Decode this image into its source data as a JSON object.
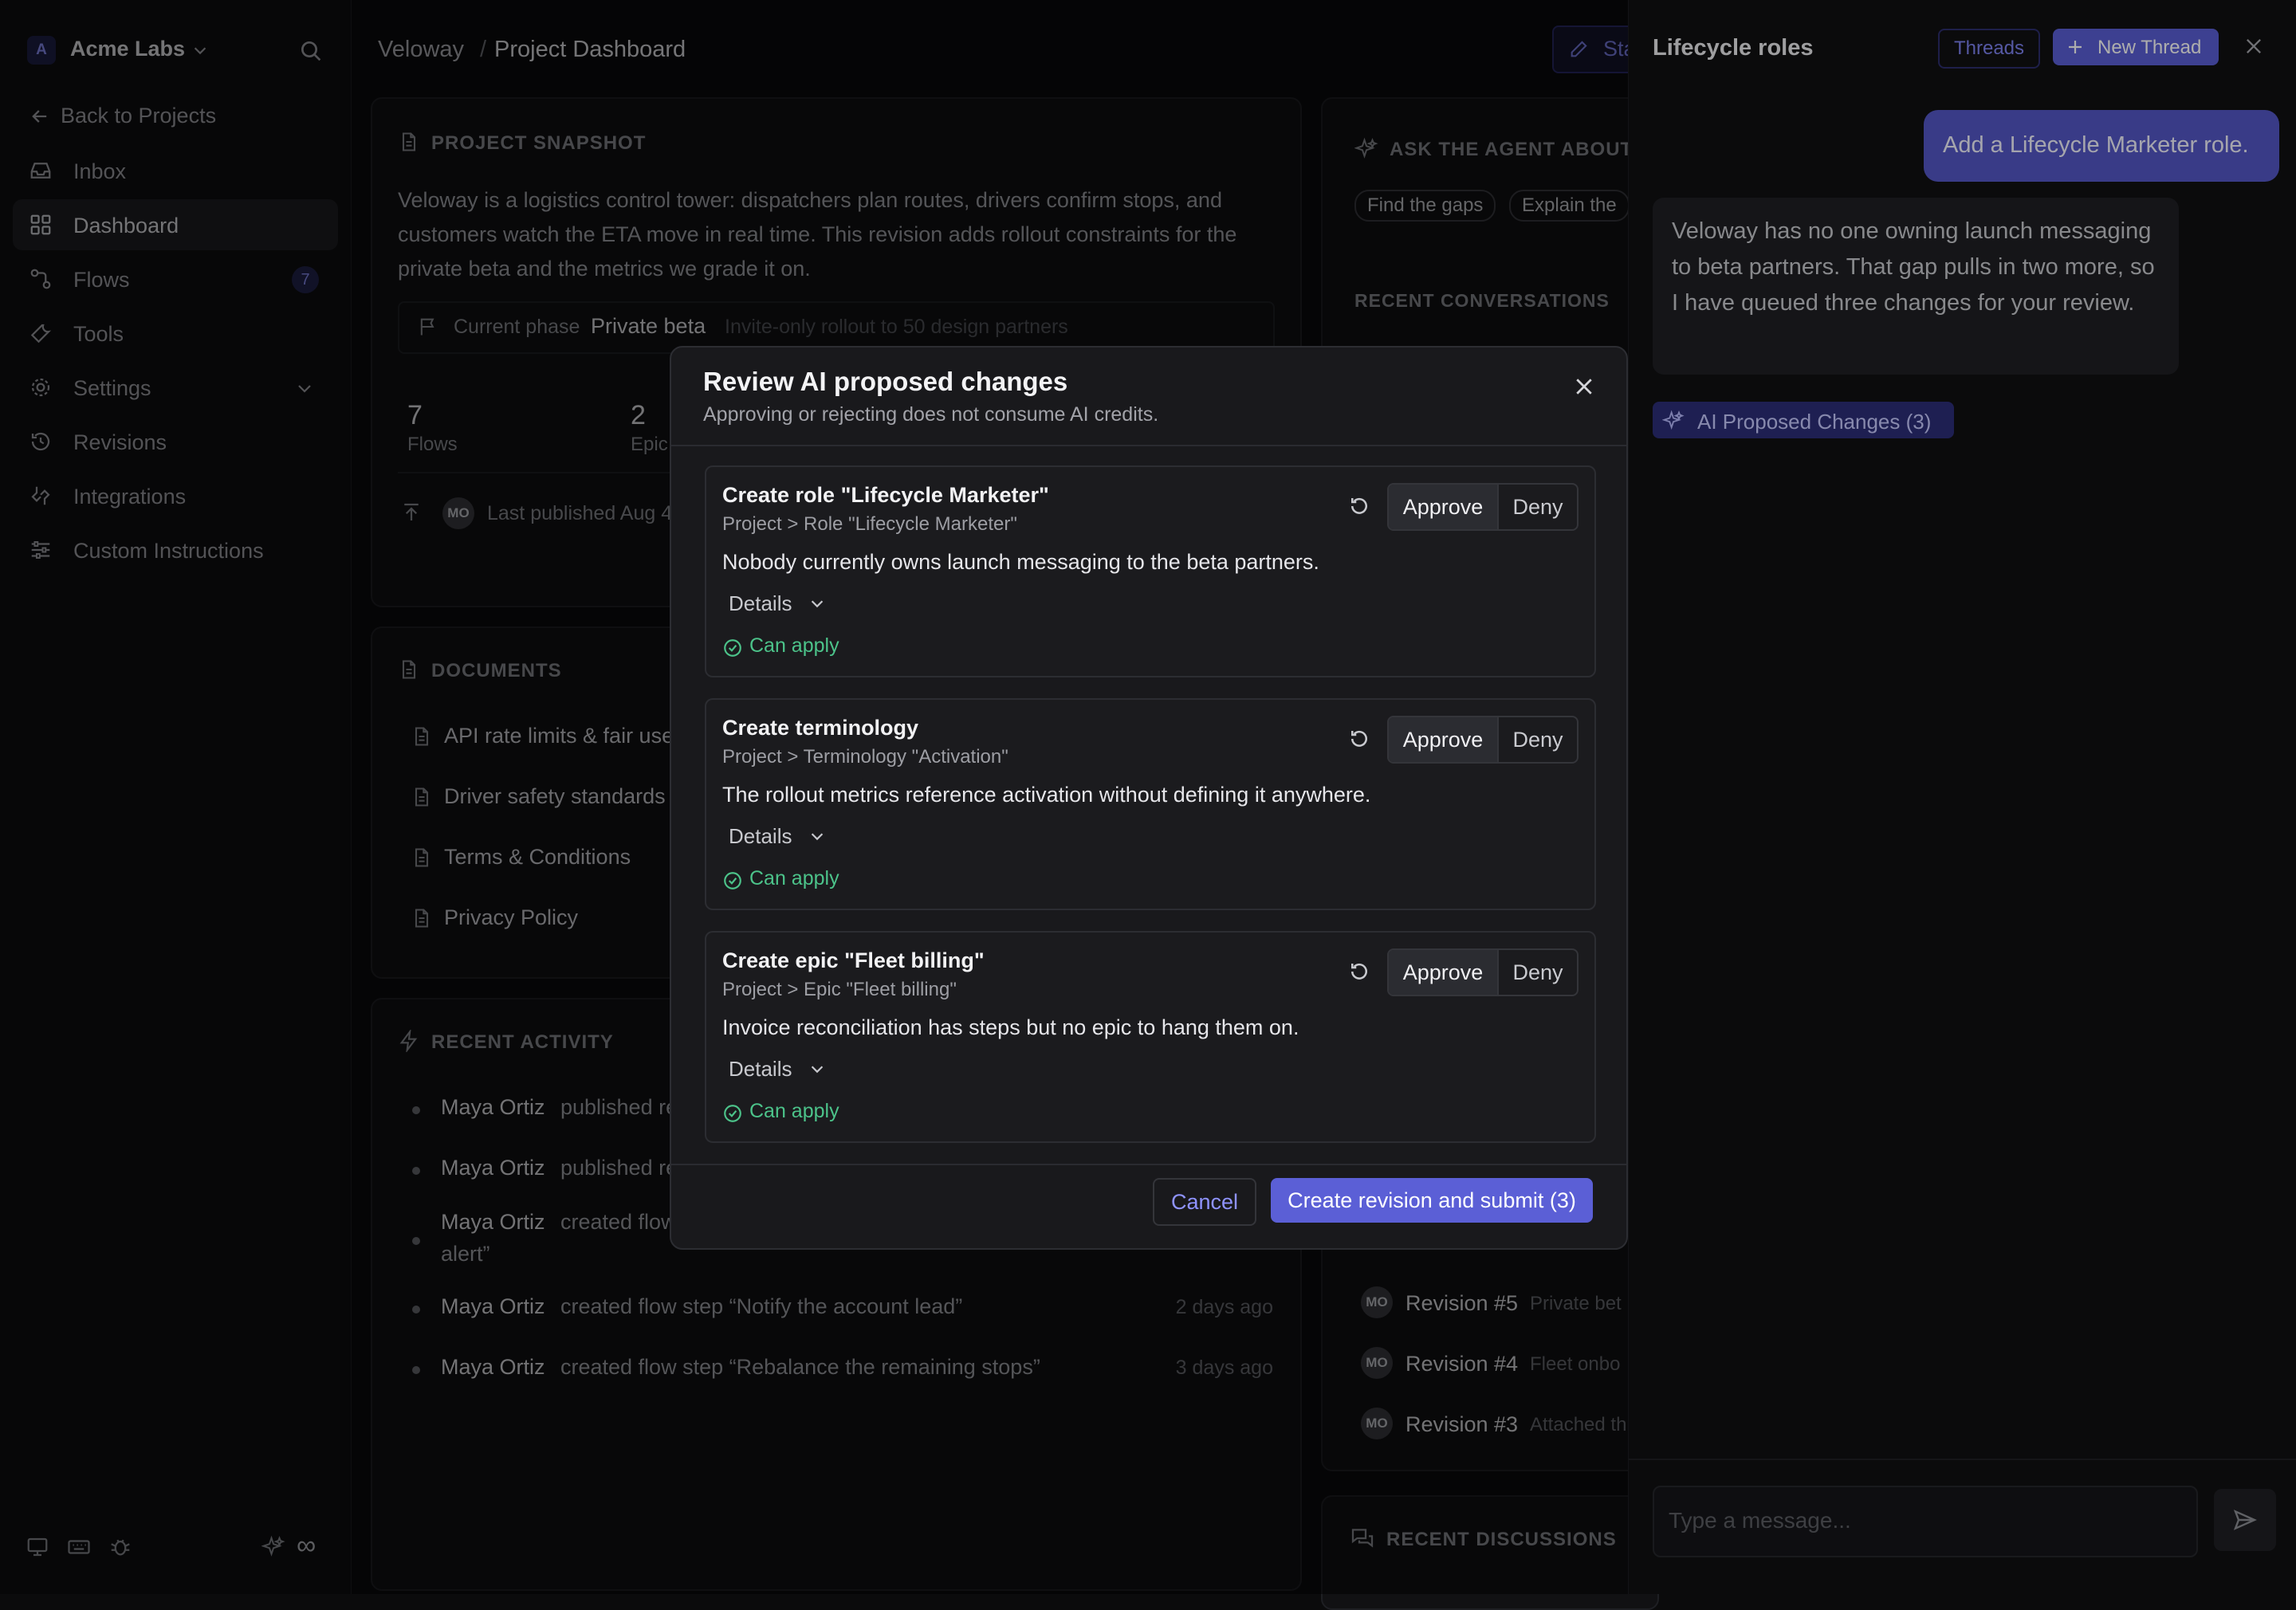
{
  "workspace": {
    "initial": "A",
    "name": "Acme Labs"
  },
  "sidebar": {
    "back": "Back to Projects",
    "items": [
      {
        "label": "Inbox",
        "icon": "inbox-icon"
      },
      {
        "label": "Dashboard",
        "icon": "grid-icon",
        "active": true
      },
      {
        "label": "Flows",
        "icon": "flows-icon",
        "badge": "7"
      },
      {
        "label": "Tools",
        "icon": "wrench-icon"
      },
      {
        "label": "Settings",
        "icon": "gear-icon"
      },
      {
        "label": "Revisions",
        "icon": "history-icon"
      },
      {
        "label": "Integrations",
        "icon": "integrations-icon"
      },
      {
        "label": "Custom Instructions",
        "icon": "sliders-icon"
      }
    ],
    "footer_infinity": "∞"
  },
  "breadcrumb": {
    "project": "Veloway",
    "separator": "/",
    "page": "Project Dashboard"
  },
  "header_button_partial": "Sta",
  "snapshot": {
    "title": "PROJECT SNAPSHOT",
    "description": "Veloway is a logistics control tower: dispatchers plan routes, drivers confirm stops, and customers watch the ETA move in real time. This revision adds rollout constraints for the private beta and the metrics we grade it on.",
    "phase_label": "Current phase",
    "phase_value": "Private beta",
    "phase_note": "Invite-only rollout to 50 design partners",
    "stats": [
      {
        "value": "7",
        "label": "Flows"
      },
      {
        "value": "2",
        "label": "Epic"
      }
    ],
    "avatar": "MO",
    "last_published": "Last published Aug 4"
  },
  "documents": {
    "title": "DOCUMENTS",
    "items": [
      "API rate limits & fair use",
      "Driver safety standards",
      "Terms & Conditions",
      "Privacy Policy"
    ]
  },
  "activity": {
    "title": "RECENT ACTIVITY",
    "items": [
      {
        "user": "Maya Ortiz",
        "text": "published re",
        "time": ""
      },
      {
        "user": "Maya Ortiz",
        "text": "published re",
        "time": ""
      },
      {
        "user": "Maya Ortiz",
        "text": "created flow",
        "text2": "alert”",
        "time": ""
      },
      {
        "user": "Maya Ortiz",
        "text": "created flow step “Notify the account lead”",
        "time": "2 days ago"
      },
      {
        "user": "Maya Ortiz",
        "text": "created flow step “Rebalance the remaining stops”",
        "time": "3 days ago"
      }
    ]
  },
  "agent": {
    "title": "ASK THE AGENT ABOUT T",
    "chips": [
      "Find the gaps",
      "Explain the"
    ],
    "recent_title": "RECENT CONVERSATIONS",
    "revisions": [
      {
        "avatar": "MO",
        "name": "Revision #5",
        "note": "Private bet"
      },
      {
        "avatar": "MO",
        "name": "Revision #4",
        "note": "Fleet onbo"
      },
      {
        "avatar": "MO",
        "name": "Revision #3",
        "note": "Attached th"
      }
    ],
    "discussions_title": "RECENT DISCUSSIONS"
  },
  "chat": {
    "title": "Lifecycle roles",
    "threads_button": "Threads",
    "new_thread_button": "New Thread",
    "user_message": "Add a Lifecycle Marketer role.",
    "assistant_message": "Veloway has no one owning launch messaging to beta partners. That gap pulls in two more, so I have queued three changes for your review.",
    "proposed_changes_button": "AI Proposed Changes (3)",
    "input_placeholder": "Type a message..."
  },
  "modal": {
    "title": "Review AI proposed changes",
    "subtitle": "Approving or rejecting does not consume AI credits.",
    "approve": "Approve",
    "deny": "Deny",
    "details": "Details",
    "can_apply": "Can apply",
    "changes": [
      {
        "title": "Create role \"Lifecycle Marketer\"",
        "path": "Project > Role \"Lifecycle Marketer\"",
        "description": "Nobody currently owns launch messaging to the beta partners."
      },
      {
        "title": "Create terminology",
        "path": "Project > Terminology \"Activation\"",
        "description": "The rollout metrics reference activation without defining it anywhere."
      },
      {
        "title": "Create epic \"Fleet billing\"",
        "path": "Project > Epic \"Fleet billing\"",
        "description": "Invoice reconciliation has steps but no epic to hang them on."
      }
    ],
    "cancel": "Cancel",
    "submit": "Create revision and submit (3)"
  },
  "colors": {
    "accent": "#5b5fd6",
    "success": "#4cc38a",
    "user_bubble": "#5558c8"
  }
}
